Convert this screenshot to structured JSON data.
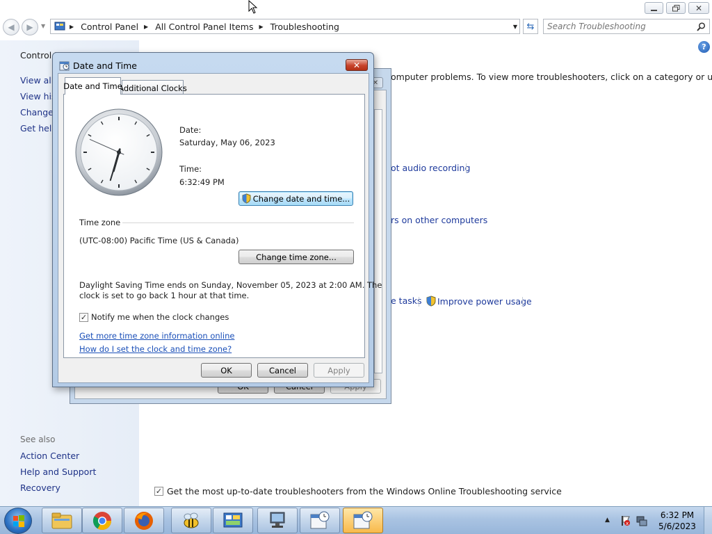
{
  "explorer": {
    "breadcrumb": [
      "Control Panel",
      "All Control Panel Items",
      "Troubleshooting"
    ],
    "search_placeholder": "Search Troubleshooting",
    "nav": {
      "control_panel_home": "Control P",
      "view_all": "View all",
      "view_history": "View hist",
      "change_settings": "Change s",
      "get_help": "Get help",
      "see_also_heading": "See also",
      "action_center": "Action Center",
      "help_and_support": "Help and Support",
      "recovery": "Recovery"
    },
    "content": {
      "intro": "omputer problems. To view more troubleshooters, click on a category or use the",
      "link_audio": "ot audio recording",
      "link_other_computers": "rs on other computers",
      "link_tasks": "e tasks",
      "link_power": "Improve power usage",
      "online_checkbox_label": "Get the most up-to-date troubleshooters from the Windows Online Troubleshooting service",
      "online_checked": true,
      "under_ok": "OK",
      "under_cancel": "Cancel",
      "under_apply": "Apply"
    }
  },
  "dialog": {
    "title": "Date and Time",
    "tabs": [
      "Date and Time",
      "Additional Clocks"
    ],
    "date_label": "Date:",
    "date_value": "Saturday, May 06, 2023",
    "time_label": "Time:",
    "time_value": "6:32:49 PM",
    "change_datetime_button": "Change date and time...",
    "timezone_heading": "Time zone",
    "timezone_value": "(UTC-08:00) Pacific Time (US & Canada)",
    "change_timezone_button": "Change time zone...",
    "dst_text_line1": "Daylight Saving Time ends on Sunday, November 05, 2023 at 2:00 AM. The",
    "dst_text_line2": "clock is set to go back 1 hour at that time.",
    "notify_label": "Notify me when the clock changes",
    "notify_checked": true,
    "link_more_info": "Get more time zone information online",
    "link_how_set": "How do I set the clock and time zone?",
    "ok": "OK",
    "cancel": "Cancel",
    "apply": "Apply",
    "clock": {
      "hour": 6,
      "minute": 32,
      "second": 49
    }
  },
  "taskbar": {
    "items": [
      "start-orb",
      "file-explorer",
      "chrome",
      "firefox",
      "bee-app",
      "control-panel",
      "network-computer",
      "calendar-clock",
      "calendar-clock-active"
    ],
    "time": "6:32 PM",
    "date": "5/6/2023"
  },
  "colors": {
    "link": "#1a4fb8",
    "nav_pane": "#eef3fa",
    "taskbar": "#a9c3e2",
    "dialog_frame": "#c6daf0"
  }
}
